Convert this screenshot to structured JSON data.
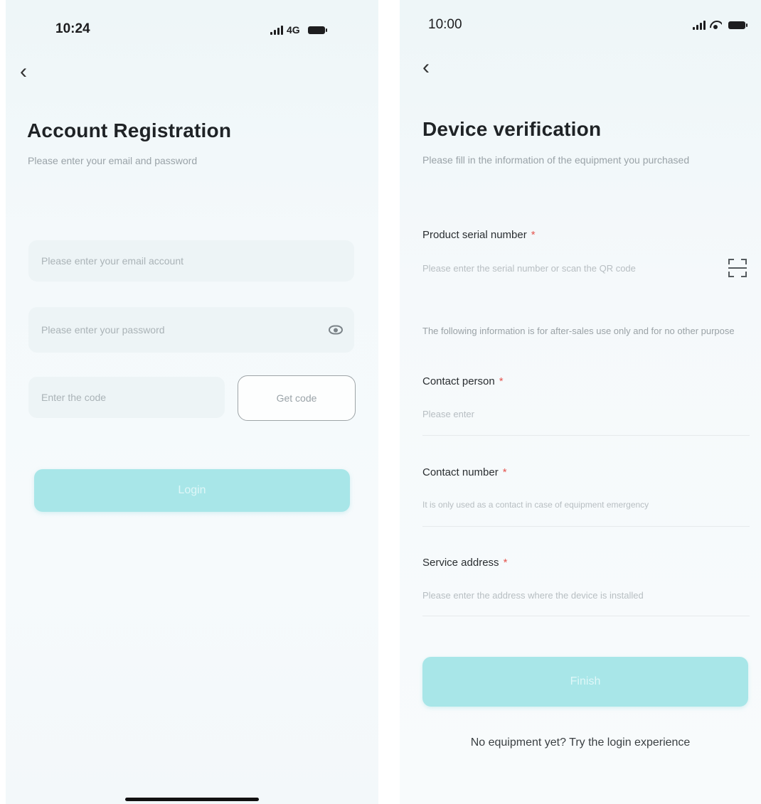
{
  "left": {
    "status": {
      "time": "10:24",
      "network": "4G"
    },
    "title": "Account Registration",
    "subtitle": "Please enter your email and password",
    "email_placeholder": "Please enter your email account",
    "password_placeholder": "Please enter your password",
    "code_placeholder": "Enter the code",
    "get_code_label": "Get code",
    "submit_label": "Login"
  },
  "right": {
    "status": {
      "time": "10:00"
    },
    "title": "Device verification",
    "subtitle": "Please fill in the information of the equipment you purchased",
    "serial": {
      "label": "Product serial number",
      "placeholder": "Please enter the serial number or scan the QR code"
    },
    "note": "The following information is for after-sales use only and for no other purpose",
    "contact_person": {
      "label": "Contact person",
      "placeholder": "Please enter"
    },
    "contact_number": {
      "label": "Contact number",
      "placeholder": "It is only used as a contact in case of equipment emergency"
    },
    "service_address": {
      "label": "Service address",
      "placeholder": "Please enter the address where the device is installed"
    },
    "required_mark": "*",
    "submit_label": "Finish",
    "experience_link": "No equipment yet? Try the login experience"
  },
  "colors": {
    "accent": "#a8e6e8",
    "required": "#e5554f"
  },
  "icons": [
    "signal-icon",
    "battery-icon",
    "wifi-icon",
    "back-chevron-icon",
    "eye-icon",
    "scan-icon"
  ]
}
